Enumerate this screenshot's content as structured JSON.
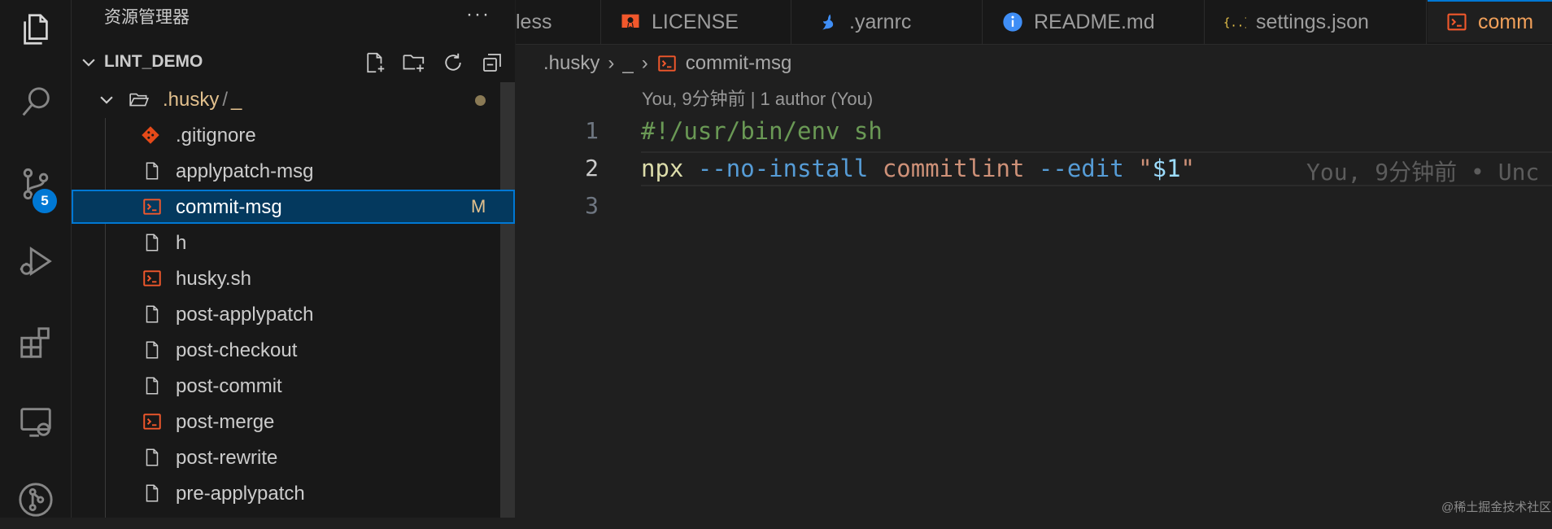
{
  "sidebar": {
    "title": "资源管理器",
    "more": "···",
    "section": "LINT_DEMO",
    "folder": {
      "name": ".husky",
      "sep": "/",
      "sub": "_"
    },
    "files": [
      {
        "name": ".gitignore",
        "icon": "git-icon"
      },
      {
        "name": "applypatch-msg",
        "icon": "file-icon"
      },
      {
        "name": "commit-msg",
        "icon": "terminal-icon",
        "selected": true,
        "status": "M"
      },
      {
        "name": "h",
        "icon": "file-icon"
      },
      {
        "name": "husky.sh",
        "icon": "terminal-icon"
      },
      {
        "name": "post-applypatch",
        "icon": "file-icon"
      },
      {
        "name": "post-checkout",
        "icon": "file-icon"
      },
      {
        "name": "post-commit",
        "icon": "file-icon"
      },
      {
        "name": "post-merge",
        "icon": "terminal-icon"
      },
      {
        "name": "post-rewrite",
        "icon": "file-icon"
      },
      {
        "name": "pre-applypatch",
        "icon": "file-icon"
      }
    ]
  },
  "activity": {
    "scm_badge": "5"
  },
  "tabs": [
    {
      "label": "less",
      "icon": ""
    },
    {
      "label": "LICENSE",
      "icon": "license-icon"
    },
    {
      "label": ".yarnrc",
      "icon": "yarn-icon"
    },
    {
      "label": "README.md",
      "icon": "info-icon"
    },
    {
      "label": "settings.json",
      "icon": "json-icon"
    },
    {
      "label": "comm",
      "icon": "terminal-icon",
      "active": true
    }
  ],
  "breadcrumb": [
    ".husky",
    "_",
    "commit-msg"
  ],
  "editor": {
    "blame_header": "You, 9分钟前 | 1 author (You)",
    "line_numbers": [
      "1",
      "2",
      "3"
    ],
    "line1": "#!/usr/bin/env sh",
    "line2": {
      "cmd": "npx",
      "opt1": "--no-install",
      "word": "commitlint",
      "opt2": "--edit",
      "q1": "\"",
      "var": "$1",
      "q2": "\""
    },
    "inline_blame": "You, 9分钟前 • Unc"
  },
  "watermark": "@稀土掘金技术社区",
  "colors": {
    "accent": "#0078d4",
    "terminal_icon": "#f1582c",
    "modified": "#e2c08d"
  }
}
